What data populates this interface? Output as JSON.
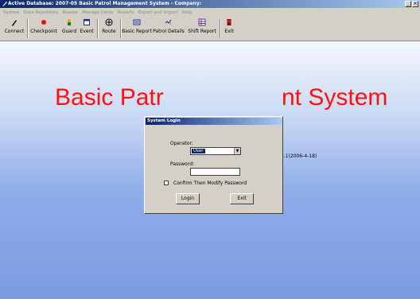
{
  "window": {
    "title": "Active Database: 2007-05 Basic Patrol Management System - Company:",
    "minimize": "_",
    "close": "×"
  },
  "menu": [
    "System",
    "Data Repository",
    "Reader",
    "Manage Cards",
    "Reports",
    "Export and Import",
    "Help"
  ],
  "toolbar": [
    "Connect",
    "Checkpoint",
    "Guard",
    "Event",
    "Route",
    "Basic Report",
    "Patrol Details",
    "Shift Report",
    "Exit"
  ],
  "main": {
    "title_left": "Basic Patr",
    "title_right": "nt System",
    "version": "3.1(2006-4-18)"
  },
  "login": {
    "title": "System Login",
    "operator_label": "Operator:",
    "operator_value": "User",
    "password_label": "Password:",
    "password_value": "",
    "confirm_label": "Confirm Then Modify Password",
    "login_button": "Login",
    "exit_button": "Exit"
  },
  "colors": {
    "title_red": "#ff1010",
    "titlebar_blue": "#0a246a",
    "desktop_blue": "#7b9be0"
  }
}
